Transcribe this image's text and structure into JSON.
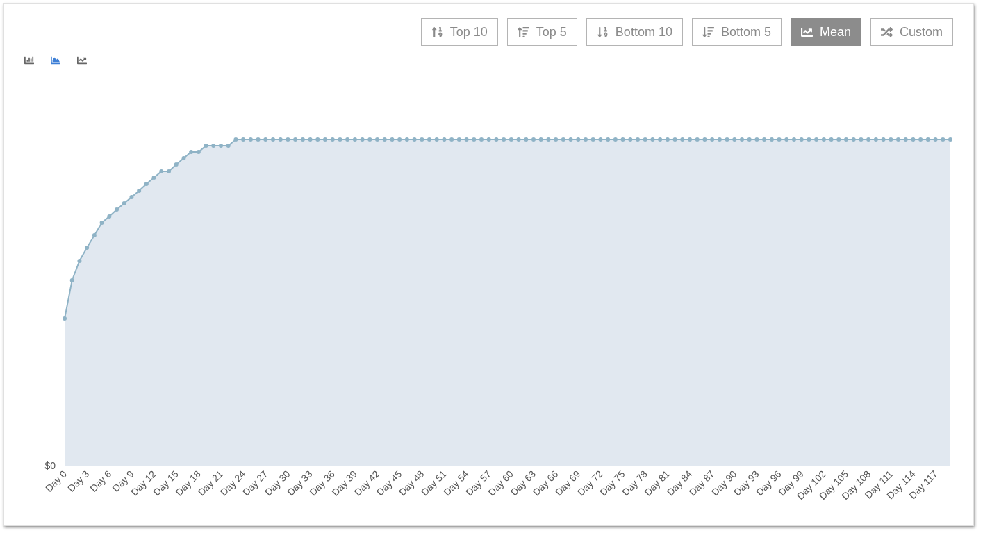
{
  "filters": [
    {
      "label": "Top 10",
      "kind": "numup",
      "selected": false
    },
    {
      "label": "Top 5",
      "kind": "amountup",
      "selected": false
    },
    {
      "label": "Bottom 10",
      "kind": "numdown",
      "selected": false
    },
    {
      "label": "Bottom 5",
      "kind": "amountdown",
      "selected": false
    },
    {
      "label": "Mean",
      "kind": "mean",
      "selected": true
    },
    {
      "label": "Custom",
      "kind": "custom",
      "selected": false
    }
  ],
  "chart_types": [
    {
      "kind": "bar",
      "selected": false
    },
    {
      "kind": "area",
      "selected": true
    },
    {
      "kind": "line",
      "selected": false
    }
  ],
  "chart": {
    "y_tick": "$0",
    "x_labels": [
      "Day 0",
      "Day 3",
      "Day 6",
      "Day 9",
      "Day 12",
      "Day 15",
      "Day 18",
      "Day 21",
      "Day 24",
      "Day 27",
      "Day 30",
      "Day 33",
      "Day 36",
      "Day 39",
      "Day 42",
      "Day 45",
      "Day 48",
      "Day 51",
      "Day 54",
      "Day 57",
      "Day 60",
      "Day 63",
      "Day 66",
      "Day 69",
      "Day 72",
      "Day 75",
      "Day 78",
      "Day 81",
      "Day 84",
      "Day 87",
      "Day 90",
      "Day 93",
      "Day 96",
      "Day 99",
      "Day 102",
      "Day 105",
      "Day 108",
      "Day 111",
      "Day 114",
      "Day 117"
    ]
  }
}
